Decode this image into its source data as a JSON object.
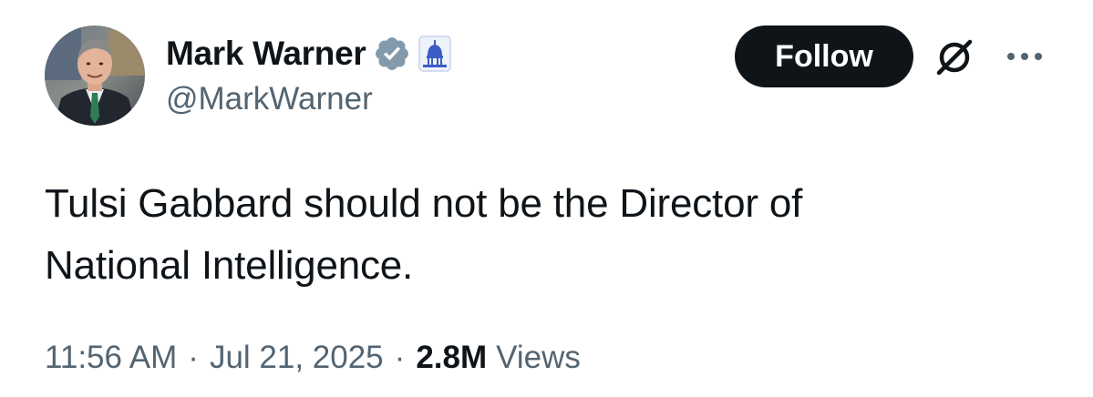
{
  "author": {
    "display_name": "Mark Warner",
    "handle": "@MarkWarner",
    "verified_icon": "verified-badge-icon",
    "affiliation_icon": "capitol-building-icon",
    "avatar": "avatar-photo"
  },
  "actions": {
    "follow_label": "Follow",
    "grok_icon": "grok-icon",
    "more_icon": "more-options-icon"
  },
  "tweet": {
    "text_line1": "Tulsi Gabbard should not be the Director of",
    "text_line2": "National Intelligence."
  },
  "meta": {
    "time": "11:56 AM",
    "separator": "·",
    "date": "Jul 21, 2025",
    "views_count": "2.8M",
    "views_label": "Views"
  },
  "colors": {
    "text_primary": "#0f1419",
    "text_secondary": "#536471",
    "verified_badge": "#829aab",
    "follow_bg": "#0f1419",
    "gov_badge": "#3b5cc4"
  }
}
